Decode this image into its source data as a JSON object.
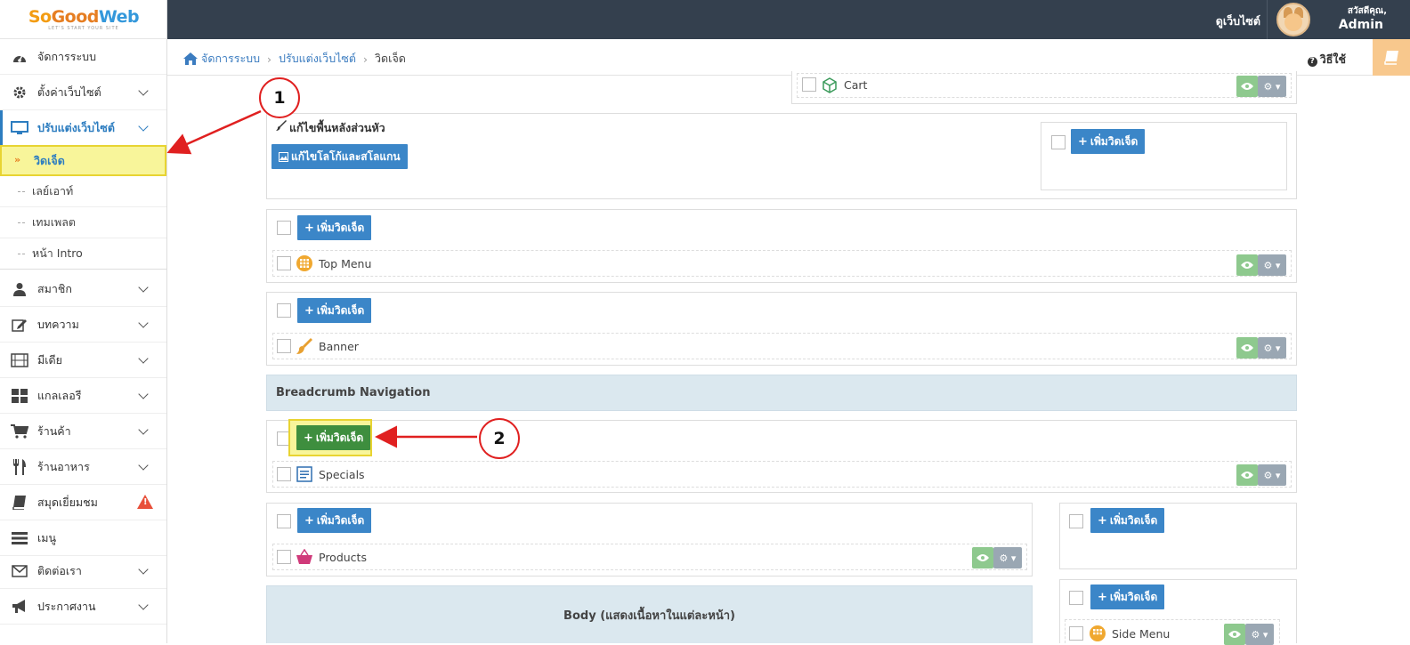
{
  "logo": {
    "brand_so": "So",
    "brand_good": "Good",
    "brand_web": "Web",
    "tagline": "LET'S START YOUR SITE"
  },
  "topbar": {
    "view_site": "ดูเว็บไซต์",
    "greeting": "สวัสดีคุณ,",
    "user": "Admin"
  },
  "sidebar": {
    "items": [
      {
        "label": "จัดการระบบ",
        "icon": "dashboard-icon"
      },
      {
        "label": "ตั้งค่าเว็บไซต์",
        "icon": "gear-icon"
      },
      {
        "label": "ปรับแต่งเว็บไซต์",
        "icon": "monitor-icon"
      },
      {
        "label": "สมาชิก",
        "icon": "user-icon"
      },
      {
        "label": "บทความ",
        "icon": "edit-icon"
      },
      {
        "label": "มีเดีย",
        "icon": "film-icon"
      },
      {
        "label": "แกลเลอรี",
        "icon": "grid-icon"
      },
      {
        "label": "ร้านค้า",
        "icon": "cart-icon"
      },
      {
        "label": "ร้านอาหาร",
        "icon": "utensils-icon"
      },
      {
        "label": "สมุดเยี่ยมชม",
        "icon": "book-icon"
      },
      {
        "label": "เมนู",
        "icon": "menu-list-icon"
      },
      {
        "label": "ติดต่อเรา",
        "icon": "envelope-icon"
      },
      {
        "label": "ประกาศงาน",
        "icon": "megaphone-icon"
      }
    ],
    "sub_items": [
      {
        "label": "วิดเจ็ด"
      },
      {
        "label": "เลย์เอาท์"
      },
      {
        "label": "เทมเพลต"
      },
      {
        "label": "หน้า Intro"
      }
    ]
  },
  "breadcrumb": {
    "home": "จัดการระบบ",
    "section": "ปรับแต่งเว็บไซต์",
    "current": "วิดเจ็ด"
  },
  "help": {
    "label": "วิธีใช้"
  },
  "content": {
    "add_widget": "เพิ่มวิดเจ็ด",
    "header_bg_title": "แก้ไขพื้นหลังส่วนหัว",
    "edit_logo_button": "แก้ไขโลโก้และสโลแกน",
    "breadcrumb_section": "Breadcrumb Navigation",
    "body_section": "Body (แสดงเนื้อหาในแต่ละหน้า)",
    "widgets": {
      "cart": "Cart",
      "top_menu": "Top Menu",
      "banner": "Banner",
      "specials": "Specials",
      "products": "Products",
      "side_menu": "Side Menu"
    }
  },
  "callouts": {
    "one": "1",
    "two": "2"
  },
  "colors": {
    "accent": "#3b86c8",
    "topbar": "#34404e",
    "highlight": "#f8f59a",
    "callout": "#e02020"
  }
}
